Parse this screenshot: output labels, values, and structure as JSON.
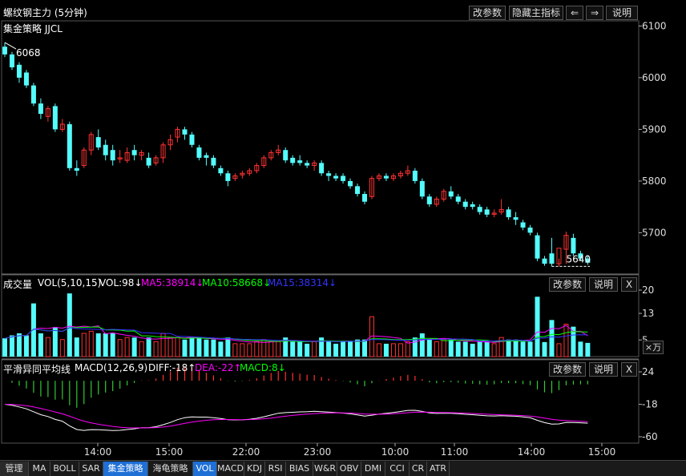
{
  "header": {
    "title": "螺纹钢主力 (5分钟)",
    "buttons": {
      "params": "改参数",
      "hide": "隐藏主指标",
      "prev": "⇐",
      "next": "⇒",
      "help": "说明"
    }
  },
  "main_panel": {
    "indicator_label": "集金策略 JJCL",
    "high_label": "6068",
    "low_label": "5640",
    "price_axis": [
      "6100",
      "6000",
      "5900",
      "5800",
      "5700"
    ]
  },
  "volume_panel": {
    "name": "成交量",
    "formula": "VOL(5,10,15)",
    "vol": "VOL:98↓",
    "ma5": "MA5:38914↓",
    "ma10": "MA10:58668↓",
    "ma15": "MA15:38314↓",
    "axis": [
      "20",
      "13",
      "5"
    ],
    "unit": "×万",
    "buttons": {
      "params": "改参数",
      "help": "说明",
      "close": "X"
    }
  },
  "macd_panel": {
    "name": "平滑异同平均线",
    "formula": "MACD(12,26,9)",
    "diff": "DIFF:-18↑",
    "dea": "DEA:-22↑",
    "macd": "MACD:8↓",
    "axis": [
      "24",
      "-18",
      "-60"
    ],
    "buttons": {
      "params": "改参数",
      "help": "说明",
      "close": "X"
    }
  },
  "time_axis": [
    "14:00",
    "15:00",
    "22:00",
    "23:00",
    "10:00",
    "11:00",
    "14:00",
    "15:00"
  ],
  "tabs": [
    "管理",
    "MA",
    "BOLL",
    "SAR",
    "集金策略",
    "海龟策略",
    "VOL",
    "MACD",
    "KDJ",
    "RSI",
    "BIAS",
    "W&R",
    "OBV",
    "DMI",
    "CCI",
    "CR",
    "ATR"
  ],
  "colors": {
    "up": "#ff3232",
    "down": "#54fcfc",
    "ma5": "#ff00ff",
    "ma10": "#00ff00",
    "ma15": "#3333ff",
    "diff": "#ffffff",
    "dea": "#ff00ff",
    "macd_pos": "#ff3232",
    "macd_neg": "#32c832"
  },
  "chart_data": {
    "type": "candlestick",
    "title": "螺纹钢主力 (5分钟)",
    "y_range": [
      5620,
      6110
    ],
    "candles": [
      [
        6060,
        6068,
        6045,
        6040
      ],
      [
        6045,
        6050,
        6020,
        6015
      ],
      [
        6025,
        6030,
        6000,
        5990
      ],
      [
        6010,
        6015,
        5985,
        5980
      ],
      [
        5985,
        5990,
        5950,
        5945
      ],
      [
        5950,
        5960,
        5930,
        5920
      ],
      [
        5925,
        5945,
        5940,
        5915
      ],
      [
        5945,
        5950,
        5900,
        5895
      ],
      [
        5900,
        5920,
        5910,
        5895
      ],
      [
        5910,
        5915,
        5825,
        5820
      ],
      [
        5825,
        5840,
        5820,
        5810
      ],
      [
        5830,
        5865,
        5860,
        5825
      ],
      [
        5860,
        5895,
        5890,
        5850
      ],
      [
        5885,
        5900,
        5865,
        5860
      ],
      [
        5870,
        5880,
        5850,
        5840
      ],
      [
        5860,
        5870,
        5840,
        5830
      ],
      [
        5845,
        5860,
        5845,
        5835
      ],
      [
        5840,
        5865,
        5855,
        5835
      ],
      [
        5860,
        5870,
        5850,
        5840
      ],
      [
        5850,
        5860,
        5855,
        5840
      ],
      [
        5845,
        5855,
        5830,
        5825
      ],
      [
        5835,
        5850,
        5845,
        5830
      ],
      [
        5845,
        5875,
        5870,
        5835
      ],
      [
        5870,
        5890,
        5880,
        5860
      ],
      [
        5885,
        5905,
        5900,
        5875
      ],
      [
        5900,
        5905,
        5890,
        5880
      ],
      [
        5890,
        5895,
        5870,
        5865
      ],
      [
        5865,
        5870,
        5845,
        5840
      ],
      [
        5850,
        5855,
        5845,
        5830
      ],
      [
        5845,
        5850,
        5830,
        5825
      ],
      [
        5825,
        5830,
        5815,
        5810
      ],
      [
        5815,
        5820,
        5800,
        5790
      ],
      [
        5805,
        5815,
        5810,
        5800
      ],
      [
        5812,
        5820,
        5815,
        5805
      ],
      [
        5815,
        5825,
        5820,
        5810
      ],
      [
        5820,
        5835,
        5830,
        5815
      ],
      [
        5830,
        5850,
        5845,
        5825
      ],
      [
        5845,
        5860,
        5855,
        5840
      ],
      [
        5855,
        5870,
        5860,
        5850
      ],
      [
        5860,
        5865,
        5840,
        5835
      ],
      [
        5845,
        5850,
        5835,
        5830
      ],
      [
        5840,
        5850,
        5835,
        5830
      ],
      [
        5835,
        5840,
        5830,
        5825
      ],
      [
        5830,
        5840,
        5835,
        5820
      ],
      [
        5835,
        5840,
        5815,
        5810
      ],
      [
        5815,
        5820,
        5810,
        5800
      ],
      [
        5810,
        5815,
        5805,
        5800
      ],
      [
        5810,
        5815,
        5800,
        5795
      ],
      [
        5800,
        5805,
        5790,
        5785
      ],
      [
        5790,
        5795,
        5775,
        5770
      ],
      [
        5775,
        5780,
        5760,
        5755
      ],
      [
        5770,
        5810,
        5805,
        5765
      ],
      [
        5805,
        5815,
        5810,
        5800
      ],
      [
        5810,
        5815,
        5805,
        5800
      ],
      [
        5805,
        5815,
        5810,
        5800
      ],
      [
        5810,
        5820,
        5815,
        5805
      ],
      [
        5815,
        5830,
        5820,
        5810
      ],
      [
        5820,
        5825,
        5800,
        5795
      ],
      [
        5800,
        5805,
        5770,
        5765
      ],
      [
        5770,
        5775,
        5755,
        5750
      ],
      [
        5755,
        5770,
        5765,
        5750
      ],
      [
        5765,
        5785,
        5780,
        5760
      ],
      [
        5780,
        5790,
        5770,
        5765
      ],
      [
        5770,
        5775,
        5760,
        5755
      ],
      [
        5760,
        5765,
        5750,
        5745
      ],
      [
        5755,
        5760,
        5750,
        5745
      ],
      [
        5750,
        5755,
        5740,
        5735
      ],
      [
        5745,
        5750,
        5735,
        5730
      ],
      [
        5738,
        5745,
        5738,
        5730
      ],
      [
        5740,
        5765,
        5745,
        5735
      ],
      [
        5745,
        5750,
        5730,
        5725
      ],
      [
        5730,
        5740,
        5725,
        5715
      ],
      [
        5720,
        5725,
        5710,
        5705
      ],
      [
        5710,
        5715,
        5700,
        5695
      ],
      [
        5695,
        5700,
        5650,
        5645
      ],
      [
        5650,
        5655,
        5640,
        5636
      ],
      [
        5660,
        5690,
        5640,
        5635
      ],
      [
        5640,
        5650,
        5670,
        5635
      ],
      [
        5668,
        5702,
        5695,
        5640
      ],
      [
        5690,
        5698,
        5660,
        5655
      ],
      [
        5660,
        5665,
        5650,
        5645
      ],
      [
        5650,
        5655,
        5642,
        5638
      ]
    ]
  }
}
